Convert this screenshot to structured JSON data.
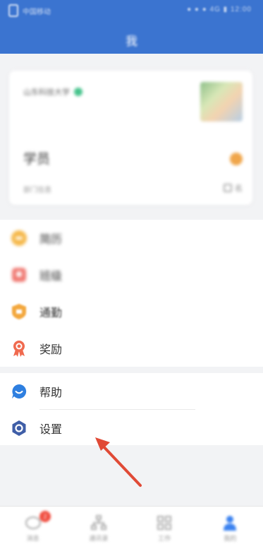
{
  "status_bar": {
    "left_text": "中国移动",
    "right_text": "● ● ● 4G ▮ 12:00"
  },
  "header": {
    "title": "我"
  },
  "profile": {
    "org_name": "山东科技大学",
    "user_name": "学员",
    "dept": "部门信息",
    "more_label": "名"
  },
  "menu_group_a": [
    {
      "label": "简历",
      "icon": "resume-icon",
      "color": "#f5b84a"
    },
    {
      "label": "班级",
      "icon": "class-icon",
      "color": "#f07a73"
    },
    {
      "label": "通勤",
      "icon": "commute-icon",
      "color": "#f3a83f"
    },
    {
      "label": "奖励",
      "icon": "award-icon",
      "color": "#f06a4f"
    }
  ],
  "menu_group_b": [
    {
      "label": "帮助",
      "icon": "help-icon",
      "color": "#2e7fe0"
    },
    {
      "label": "设置",
      "icon": "settings-icon",
      "color": "#3f5ea7"
    }
  ],
  "tabs": [
    {
      "label": "消息",
      "icon": "message-icon",
      "badge": "2"
    },
    {
      "label": "通讯录",
      "icon": "contacts-icon"
    },
    {
      "label": "工作",
      "icon": "work-icon"
    },
    {
      "label": "我的",
      "icon": "profile-icon"
    }
  ],
  "colors": {
    "header_blue": "#3b74d0",
    "annotation_arrow": "#e04a36",
    "active_tab": "#3b82f0"
  }
}
